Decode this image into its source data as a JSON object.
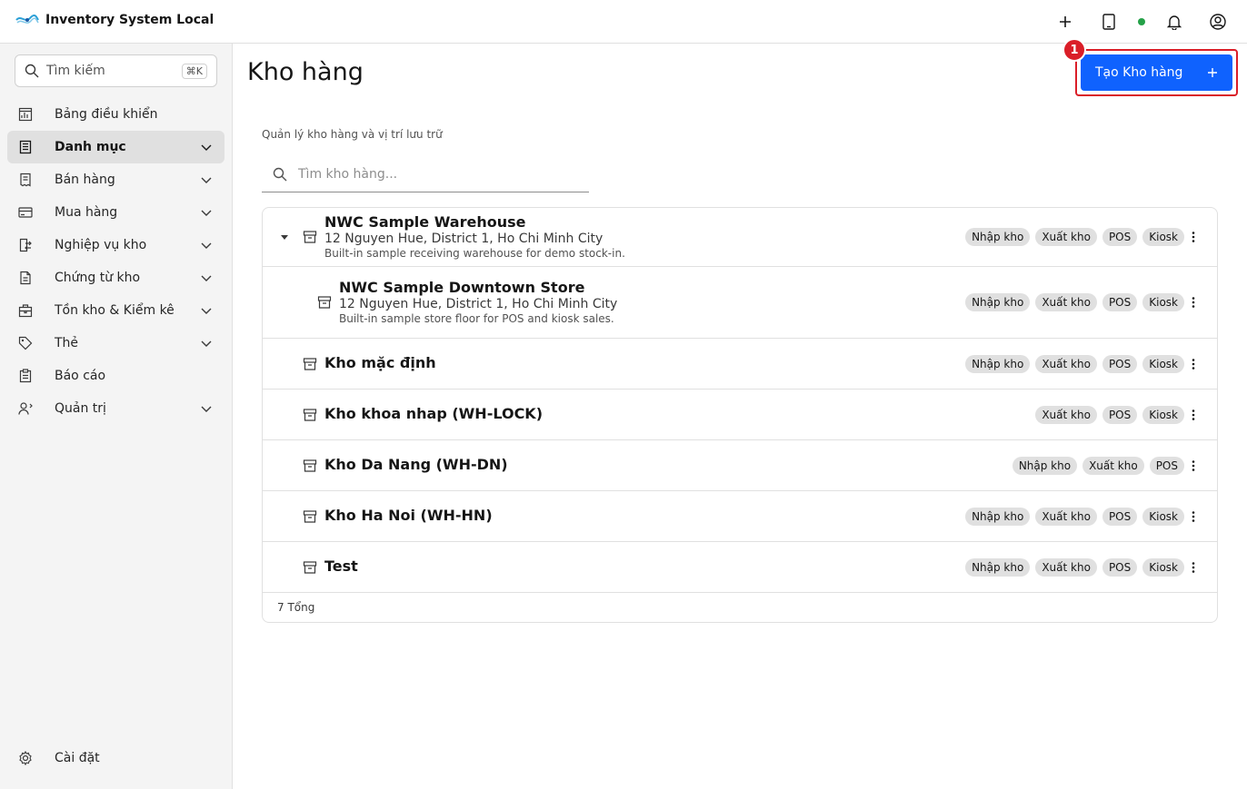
{
  "app": {
    "title": "Inventory System Local"
  },
  "sidebar": {
    "search": {
      "label": "Tìm kiếm",
      "shortcut": "⌘K"
    },
    "items": [
      {
        "label": "Bảng điều khiển",
        "icon": "dashboard-icon",
        "expandable": false
      },
      {
        "label": "Danh mục",
        "icon": "catalog-icon",
        "expandable": true,
        "active": true
      },
      {
        "label": "Bán hàng",
        "icon": "receipt-icon",
        "expandable": true
      },
      {
        "label": "Mua hàng",
        "icon": "credit-card-icon",
        "expandable": true
      },
      {
        "label": "Nghiệp vụ kho",
        "icon": "transfer-icon",
        "expandable": true
      },
      {
        "label": "Chứng từ kho",
        "icon": "document-icon",
        "expandable": true
      },
      {
        "label": "Tồn kho & Kiểm kê",
        "icon": "inventory-icon",
        "expandable": true
      },
      {
        "label": "Thẻ",
        "icon": "tag-icon",
        "expandable": true
      },
      {
        "label": "Báo cáo",
        "icon": "report-icon",
        "expandable": false
      },
      {
        "label": "Quản trị",
        "icon": "admin-icon",
        "expandable": true
      }
    ],
    "settings": {
      "label": "Cài đặt",
      "icon": "gear-icon"
    }
  },
  "main": {
    "title": "Kho hàng",
    "create_button": "Tạo Kho hàng",
    "badge": "1",
    "subtitle": "Quản lý kho hàng và vị trí lưu trữ",
    "search_placeholder": "Tìm kho hàng...",
    "rows": [
      {
        "name": "NWC Sample Warehouse",
        "address": "12 Nguyen Hue, District 1, Ho Chi Minh City",
        "description": "Built-in sample receiving warehouse for demo stock-in.",
        "tags": [
          "Nhập kho",
          "Xuất kho",
          "POS",
          "Kiosk"
        ]
      },
      {
        "name": "NWC Sample Downtown Store",
        "address": "12 Nguyen Hue, District 1, Ho Chi Minh City",
        "description": "Built-in sample store floor for POS and kiosk sales.",
        "tags": [
          "Nhập kho",
          "Xuất kho",
          "POS",
          "Kiosk"
        ]
      },
      {
        "name": "Kho mặc định",
        "tags": [
          "Nhập kho",
          "Xuất kho",
          "POS",
          "Kiosk"
        ]
      },
      {
        "name": "Kho khoa nhap (WH-LOCK)",
        "tags": [
          "Xuất kho",
          "POS",
          "Kiosk"
        ]
      },
      {
        "name": "Kho Da Nang (WH-DN)",
        "tags": [
          "Nhập kho",
          "Xuất kho",
          "POS"
        ]
      },
      {
        "name": "Kho Ha Noi (WH-HN)",
        "tags": [
          "Nhập kho",
          "Xuất kho",
          "POS",
          "Kiosk"
        ]
      },
      {
        "name": "Test",
        "tags": [
          "Nhập kho",
          "Xuất kho",
          "POS",
          "Kiosk"
        ]
      }
    ],
    "total_label": "7 Tổng"
  },
  "colors": {
    "primary": "#0f62fe",
    "highlight": "#da1e28",
    "status": "#24a148",
    "sidebar_bg": "#f4f4f4"
  }
}
